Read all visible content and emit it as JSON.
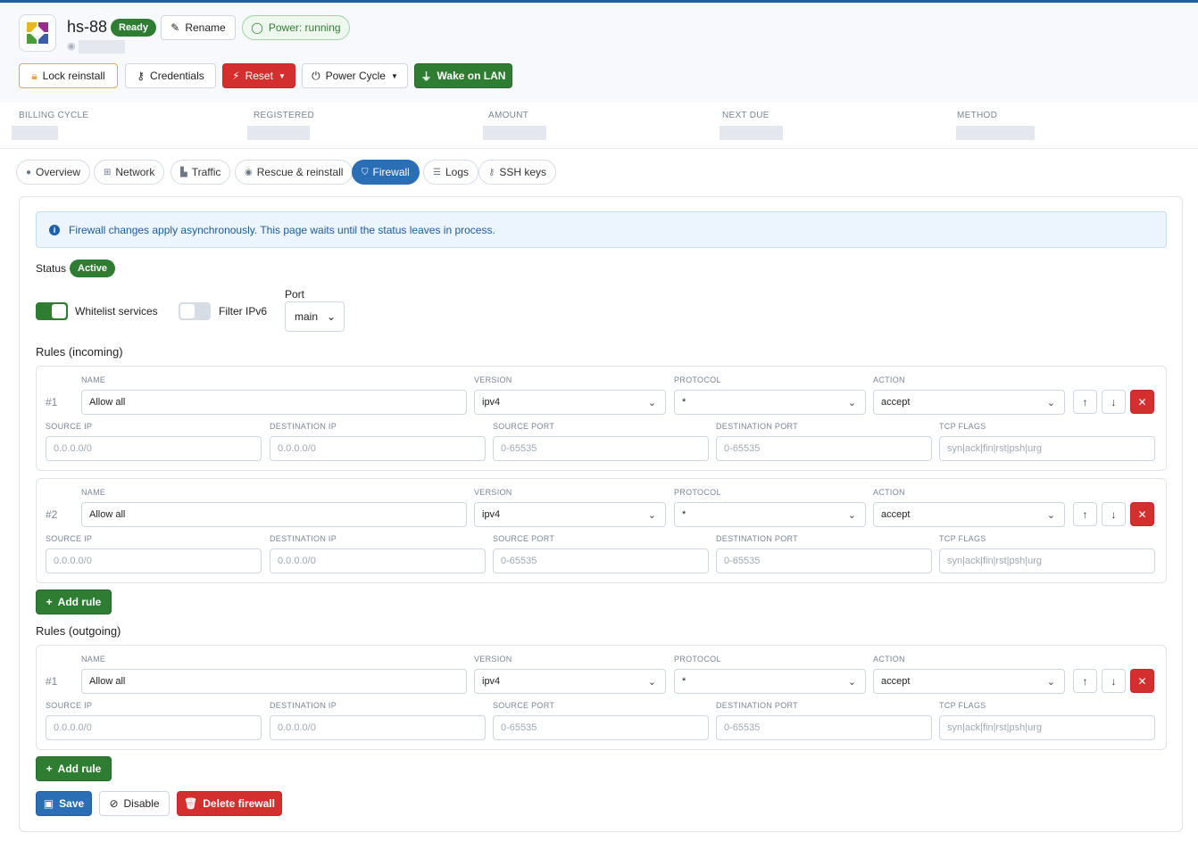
{
  "server": {
    "hostname": "hs-88",
    "ready_badge": "Ready",
    "power_status": "Power: running"
  },
  "actions": {
    "rename": "Rename",
    "lock_reinstall": "Lock reinstall",
    "credentials": "Credentials",
    "reset": "Reset",
    "power_cycle": "Power Cycle",
    "wake_on_lan": "Wake on LAN"
  },
  "billing": {
    "billing_cycle_label": "BILLING CYCLE",
    "registered_label": "REGISTERED",
    "amount_label": "AMOUNT",
    "next_due_label": "NEXT DUE",
    "method_label": "METHOD"
  },
  "tabs": [
    {
      "label": "Overview",
      "icon": "info-icon"
    },
    {
      "label": "Network",
      "icon": "network-icon"
    },
    {
      "label": "Traffic",
      "icon": "chart-icon"
    },
    {
      "label": "Rescue & reinstall",
      "icon": "lifebuoy-icon"
    },
    {
      "label": "Firewall",
      "icon": "shield-icon",
      "active": true
    },
    {
      "label": "Logs",
      "icon": "list-icon"
    },
    {
      "label": "SSH keys",
      "icon": "key-icon"
    }
  ],
  "firewall": {
    "info": "Firewall changes apply asynchronously. This page waits until the status leaves in process.",
    "status_label": "Status",
    "status_badge": "Active",
    "whitelist_label": "Whitelist services",
    "whitelist_on": true,
    "filter_ipv6_label": "Filter IPv6",
    "filter_ipv6_on": false,
    "port_label": "Port",
    "port_value": "main",
    "incoming_title": "Rules (incoming)",
    "outgoing_title": "Rules (outgoing)",
    "add_rule": "Add rule",
    "save": "Save",
    "disable": "Disable",
    "delete": "Delete firewall"
  },
  "field_labels": {
    "name": "NAME",
    "version": "VERSION",
    "protocol": "PROTOCOL",
    "action": "ACTION",
    "source_ip": "SOURCE IP",
    "destination_ip": "DESTINATION IP",
    "source_port": "SOURCE PORT",
    "destination_port": "DESTINATION PORT",
    "tcp_flags": "TCP FLAGS"
  },
  "placeholders": {
    "source_ip": "0.0.0.0/0",
    "destination_ip": "0.0.0.0/0",
    "source_port": "0-65535",
    "destination_port": "0-65535",
    "tcp_flags": "syn|ack|fin|rst|psh|urg"
  },
  "rules_incoming": [
    {
      "number": "#1",
      "name": "Allow all",
      "version": "ipv4",
      "protocol": "*",
      "action": "accept"
    },
    {
      "number": "#2",
      "name": "Allow all",
      "version": "ipv4",
      "protocol": "*",
      "action": "accept"
    }
  ],
  "rules_outgoing": [
    {
      "number": "#1",
      "name": "Allow all",
      "version": "ipv4",
      "protocol": "*",
      "action": "accept"
    }
  ],
  "colors": {
    "primary": "#2a6eb5",
    "success": "#2e7d32",
    "danger": "#d32f2f"
  }
}
